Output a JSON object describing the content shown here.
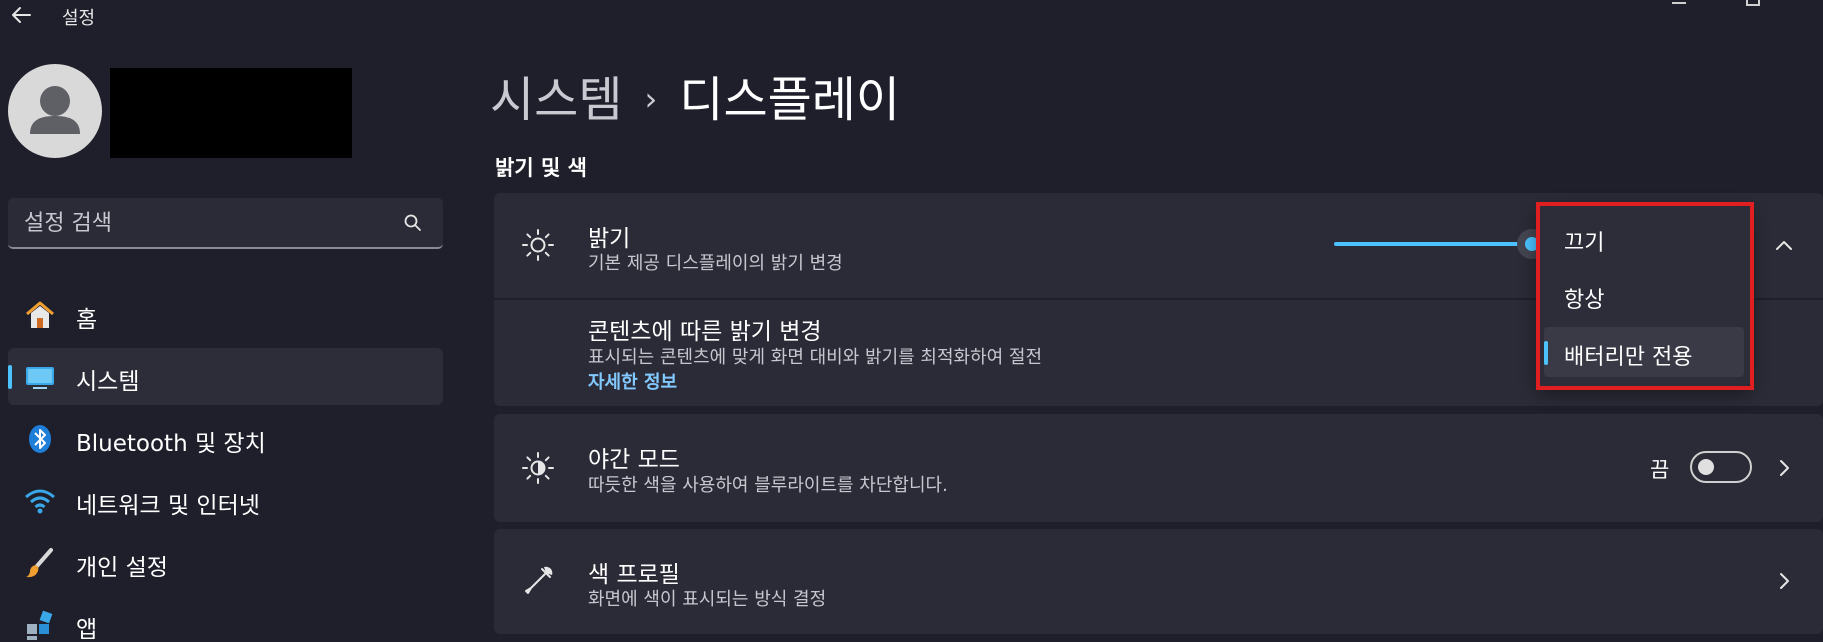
{
  "window": {
    "title": "설정"
  },
  "search": {
    "placeholder": "설정 검색"
  },
  "sidebar": {
    "items": [
      {
        "label": "홈",
        "icon": "home-icon"
      },
      {
        "label": "시스템",
        "icon": "system-icon",
        "active": true
      },
      {
        "label": "Bluetooth 및 장치",
        "icon": "bluetooth-icon"
      },
      {
        "label": "네트워크 및 인터넷",
        "icon": "wifi-icon"
      },
      {
        "label": "개인 설정",
        "icon": "brush-icon"
      },
      {
        "label": "앱",
        "icon": "apps-icon"
      }
    ]
  },
  "breadcrumb": {
    "parent": "시스템",
    "separator": "›",
    "current": "디스플레이"
  },
  "section": {
    "title": "밝기 및 색"
  },
  "brightness": {
    "title": "밝기",
    "subtitle": "기본 제공 디스플레이의 밝기 변경",
    "level": 0.9
  },
  "adaptive": {
    "title": "콘텐츠에 따른 밝기 변경",
    "subtitle": "표시되는 콘텐츠에 맞게 화면 대비와 밝기를 최적화하여 절전",
    "link": "자세한 정보"
  },
  "dropdown": {
    "options": [
      {
        "label": "끄기"
      },
      {
        "label": "항상"
      },
      {
        "label": "배터리만 전용",
        "selected": true
      }
    ]
  },
  "night": {
    "title": "야간 모드",
    "subtitle": "따듯한 색을 사용하여 블루라이트를 차단합니다.",
    "state_label": "끔",
    "on": false
  },
  "profile": {
    "title": "색 프로필",
    "subtitle": "화면에 색이 표시되는 방식 결정"
  },
  "colors": {
    "accent": "#4cc2ff",
    "highlight": "#e02020",
    "background": "#1f1f2c",
    "card": "#2b2b37"
  }
}
